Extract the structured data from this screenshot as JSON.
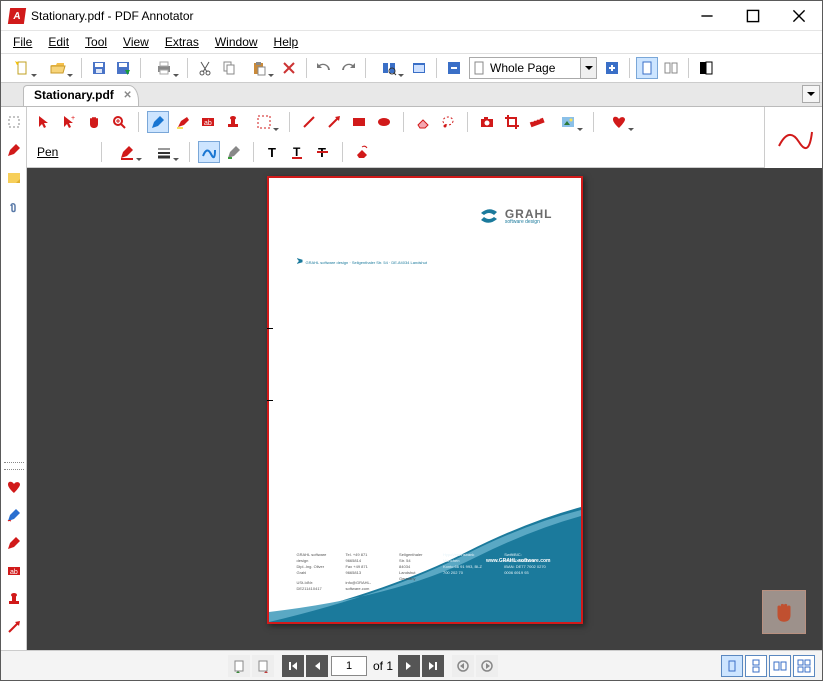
{
  "titlebar": {
    "title": "Stationary.pdf - PDF Annotator"
  },
  "menus": {
    "file": "File",
    "edit": "Edit",
    "tool": "Tool",
    "view": "View",
    "extras": "Extras",
    "window": "Window",
    "help": "Help"
  },
  "zoom": {
    "label": "Whole Page"
  },
  "tabs": {
    "active": "Stationary.pdf"
  },
  "tool_panel": {
    "label": "Pen"
  },
  "nav": {
    "page_field": "1",
    "of_label": "of 1"
  },
  "document": {
    "company_name": "GRAHL",
    "company_tagline": "software design",
    "sender_line": "GRAHL software design · Seligenthaler Str. 54 · DE-84034 Landshut",
    "footer": {
      "col1_l1": "GRAHL software design",
      "col1_l2": "Dipl.-Ing. Oliver Grahl",
      "col1_l3": "USt-IdNr: DE211410417",
      "col2_l1": "Tel.  +49 871 9665814",
      "col2_l2": "Fax  +49 871 9665813",
      "col2_l3": "info@GRAHL-software.com",
      "col3_l1": "Seligenthaler Str. 54",
      "col3_l2": "84034 Landshut",
      "col3_l3": "Germany",
      "bank1_l1": "HypoVereinsbank München",
      "bank1_l2": "Konto 66 91 993, BLZ 700 202 70",
      "bank2_l1": "Swift/BIC: HYVEDEMMXXX",
      "bank2_l2": "IBAN: DE77 7002 0270 0006 6919 93"
    },
    "domain": "www.GRAHL-software.com"
  }
}
